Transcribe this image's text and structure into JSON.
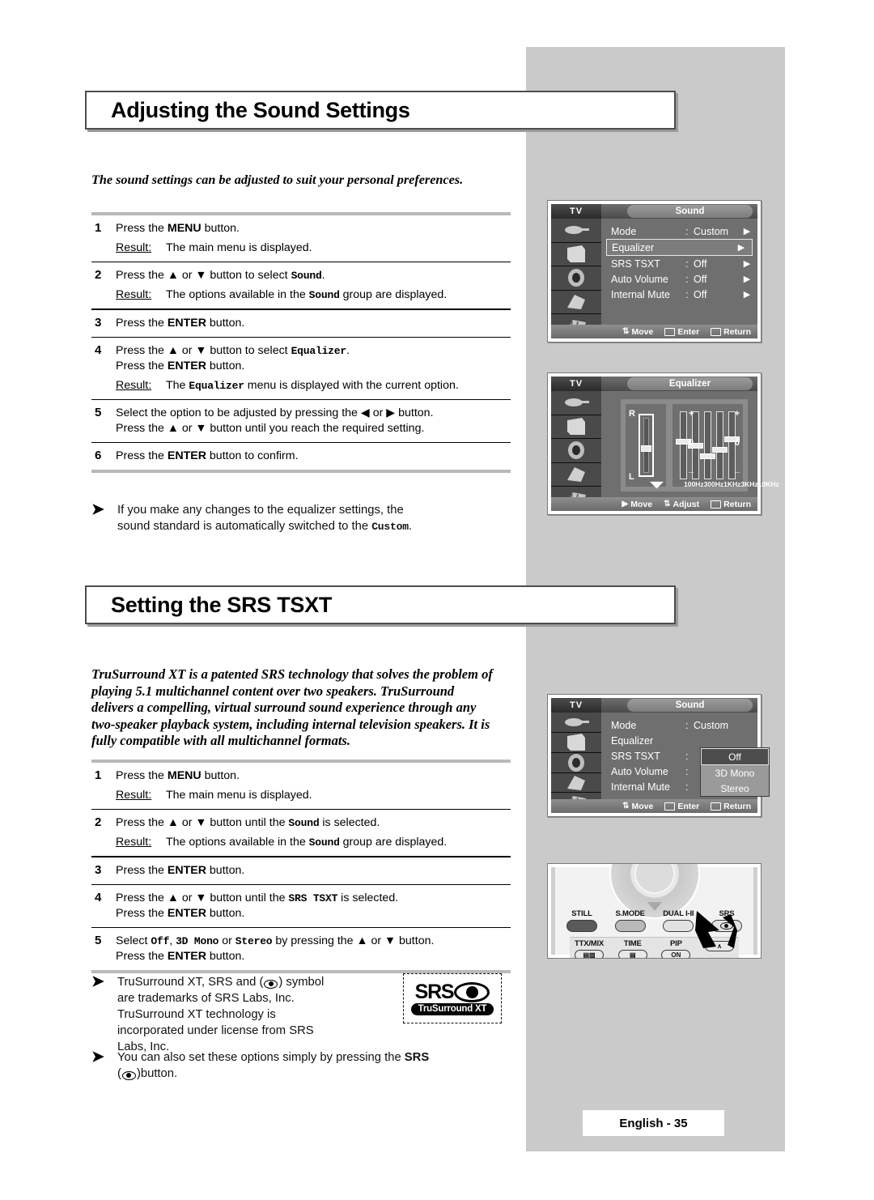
{
  "page": {
    "footer_label": "English - 35",
    "accent_grey": "#cacaca"
  },
  "section1": {
    "title": "Adjusting the Sound Settings",
    "intro": "The sound settings can be adjusted to suit your personal preferences.",
    "steps": [
      {
        "num": "1",
        "lines": [
          "Press the MENU button."
        ],
        "result_label": "Result",
        "result_text": "The main menu is displayed."
      },
      {
        "num": "2",
        "lines": [
          "Press the ▲ or ▼ button to select Sound."
        ],
        "result_label": "Result",
        "result_text": "The options available in the Sound group are displayed."
      },
      {
        "num": "3",
        "lines": [
          "Press the ENTER button."
        ],
        "result_label": "",
        "result_text": ""
      },
      {
        "num": "4",
        "lines": [
          "Press the ▲ or ▼ button to select Equalizer.",
          "Press the ENTER button."
        ],
        "result_label": "Result",
        "result_text": "The Equalizer menu is displayed with the current option."
      },
      {
        "num": "5",
        "lines": [
          "Select the option to be adjusted by pressing the ◀ or ▶ button.",
          "Press the ▲ or ▼ button until you reach the required setting."
        ],
        "result_label": "",
        "result_text": ""
      },
      {
        "num": "6",
        "lines": [
          "Press the ENTER button to confirm."
        ],
        "result_label": "",
        "result_text": ""
      }
    ],
    "note": "If you make any changes to the equalizer settings, the sound standard is automatically switched to the Custom."
  },
  "section2": {
    "title": "Setting the SRS TSXT",
    "intro": "TruSurround XT is a patented SRS technology that solves the problem of playing 5.1 multichannel content over two speakers. TruSurround delivers a compelling, virtual surround sound experience through any two-speaker playback system, including internal television speakers. It is fully compatible with all multichannel formats.",
    "steps": [
      {
        "num": "1",
        "lines": [
          "Press the MENU button."
        ],
        "result_label": "Result",
        "result_text": "The main menu is displayed."
      },
      {
        "num": "2",
        "lines": [
          "Press the ▲ or ▼ button until the Sound is selected."
        ],
        "result_label": "Result",
        "result_text": "The options available in the Sound group are displayed."
      },
      {
        "num": "3",
        "lines": [
          "Press the ENTER button."
        ],
        "result_label": "",
        "result_text": ""
      },
      {
        "num": "4",
        "lines": [
          "Press the ▲ or ▼ button until the SRS TSXT is selected.",
          "Press the ENTER button."
        ],
        "result_label": "",
        "result_text": ""
      },
      {
        "num": "5",
        "lines": [
          "Select Off, 3D Mono or Stereo by pressing the ▲ or ▼ button.",
          "Press the ENTER button."
        ],
        "result_label": "",
        "result_text": ""
      }
    ],
    "note_trademark": "TruSurround XT, SRS and (●) symbol are trademarks of SRS Labs, Inc. TruSurround XT technology is incorporated under license from SRS Labs, Inc.",
    "note_button": "You can also set these options simply by pressing the SRS (●)button."
  },
  "srs_logo": {
    "word": "SRS",
    "tagline": "TruSurround XT"
  },
  "osd_sound_1": {
    "tv_label": "TV",
    "title": "Sound",
    "rows": [
      {
        "label": "Mode",
        "colon": ":",
        "value": "Custom",
        "arrow": "▶",
        "selected": false
      },
      {
        "label": "Equalizer",
        "colon": "",
        "value": "",
        "arrow": "▶",
        "selected": true
      },
      {
        "label": "SRS TSXT",
        "colon": ":",
        "value": "Off",
        "arrow": "▶",
        "selected": false
      },
      {
        "label": "Auto Volume",
        "colon": ":",
        "value": "Off",
        "arrow": "▶",
        "selected": false
      },
      {
        "label": "Internal Mute",
        "colon": ":",
        "value": "Off",
        "arrow": "▶",
        "selected": false
      }
    ],
    "footer": {
      "move": "Move",
      "enter": "Enter",
      "return": "Return"
    }
  },
  "osd_equalizer": {
    "tv_label": "TV",
    "title": "Equalizer",
    "balance": {
      "right": "R",
      "left": "L",
      "knob_pct": 50
    },
    "plus": "+",
    "minus": "_",
    "zero": "0",
    "bands": [
      {
        "label": "100Hz",
        "knob_pct": 40
      },
      {
        "label": "300Hz",
        "knob_pct": 47
      },
      {
        "label": "1KHz",
        "knob_pct": 62
      },
      {
        "label": "3KHz",
        "knob_pct": 52
      },
      {
        "label": "10KHz",
        "knob_pct": 37
      }
    ],
    "footer": {
      "move": "Move",
      "adjust": "Adjust",
      "return": "Return"
    }
  },
  "osd_sound_2": {
    "tv_label": "TV",
    "title": "Sound",
    "rows": [
      {
        "label": "Mode",
        "colon": ":",
        "value": "Custom"
      },
      {
        "label": "Equalizer",
        "colon": "",
        "value": ""
      },
      {
        "label": "SRS TSXT",
        "colon": ":",
        "value": ""
      },
      {
        "label": "Auto Volume",
        "colon": ":",
        "value": ""
      },
      {
        "label": "Internal Mute",
        "colon": ":",
        "value": ""
      }
    ],
    "dropdown": [
      {
        "label": "Off",
        "active": true
      },
      {
        "label": "3D Mono",
        "active": false
      },
      {
        "label": "Stereo",
        "active": false
      }
    ],
    "footer": {
      "move": "Move",
      "enter": "Enter",
      "return": "Return"
    }
  },
  "remote": {
    "row1": [
      {
        "cap": "STILL",
        "style": "dark"
      },
      {
        "cap": "S.MODE",
        "style": "mid"
      },
      {
        "cap": "DUAL I-II",
        "style": "light"
      },
      {
        "cap": "SRS",
        "style": "srsb"
      }
    ],
    "row2": [
      {
        "cap": "TTX/MIX",
        "face": "▤▨"
      },
      {
        "cap": "TIME",
        "face": "▤"
      },
      {
        "cap": "PIP",
        "face": "ON"
      },
      {
        "cap": "",
        "face": "∧"
      }
    ]
  }
}
